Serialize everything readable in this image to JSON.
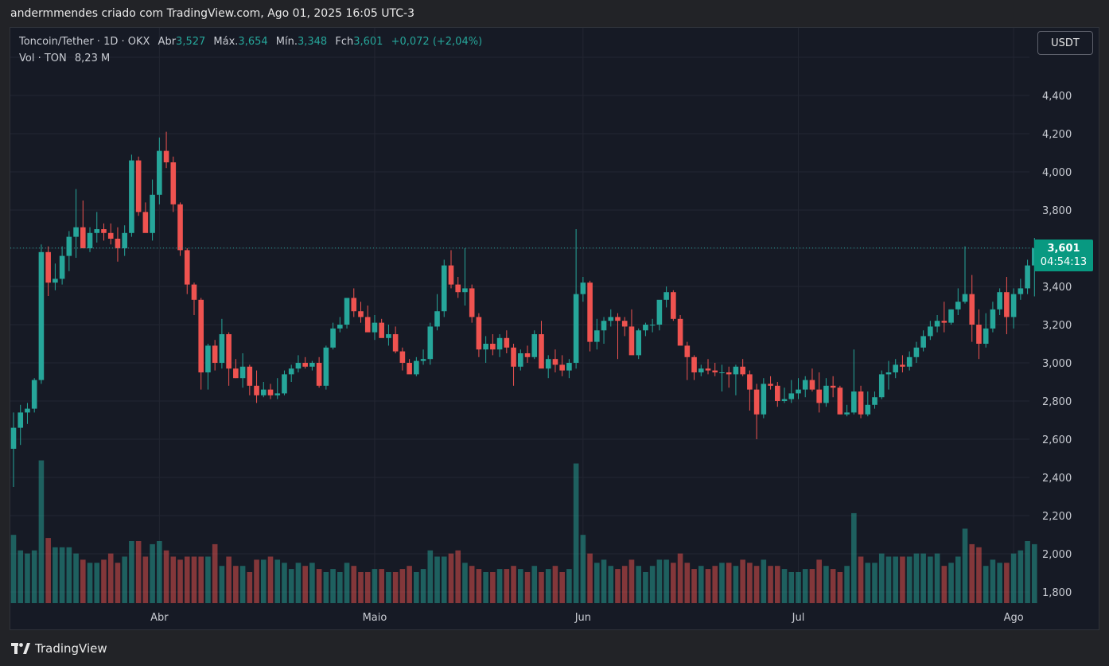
{
  "caption": "andermmendes criado com TradingView.com, Ago 01, 2025 16:05 UTC-3",
  "legend": {
    "symbol": "Toncoin/Tether · 1D · OKX",
    "open_label": "Abr",
    "open_value": "3,527",
    "high_label": "Máx.",
    "high_value": "3,654",
    "low_label": "Mín.",
    "low_value": "3,348",
    "close_label": "Fch",
    "close_value": "3,601",
    "change": "+0,072 (+2,04%)"
  },
  "volume_legend": {
    "label": "Vol · TON",
    "value": "8,23 M"
  },
  "currency_button": "USDT",
  "price_tag": {
    "last": "3,601",
    "countdown": "04:54:13"
  },
  "footer_brand": "TradingView",
  "colors": {
    "up": "#26a69a",
    "down": "#ef5350",
    "background": "#161a25",
    "grid": "#232632"
  },
  "chart_data": {
    "type": "candlestick",
    "y_axis_ticks": [
      "4,400",
      "4,200",
      "4,000",
      "3,800",
      "3,600",
      "3,400",
      "3,200",
      "3,000",
      "2,800",
      "2,600",
      "2,400",
      "2,200",
      "2,000",
      "1,800"
    ],
    "x_axis_labels": [
      "Abr",
      "Maio",
      "Jun",
      "Jul",
      "Ago"
    ],
    "ylim": [
      1.75,
      4.6
    ],
    "last_price": 3.601,
    "candles": [
      [
        2.55,
        2.74,
        2.35,
        2.66,
        2.2
      ],
      [
        2.66,
        2.78,
        2.57,
        2.74,
        1.7
      ],
      [
        2.74,
        2.79,
        2.68,
        2.76,
        1.6
      ],
      [
        2.76,
        2.92,
        2.74,
        2.91,
        1.7
      ],
      [
        2.91,
        3.62,
        2.89,
        3.58,
        4.6
      ],
      [
        3.58,
        3.61,
        3.35,
        3.42,
        2.1
      ],
      [
        3.42,
        3.52,
        3.38,
        3.44,
        1.8
      ],
      [
        3.44,
        3.61,
        3.41,
        3.56,
        1.8
      ],
      [
        3.56,
        3.69,
        3.48,
        3.66,
        1.8
      ],
      [
        3.66,
        3.91,
        3.55,
        3.71,
        1.6
      ],
      [
        3.71,
        3.85,
        3.6,
        3.6,
        1.4
      ],
      [
        3.6,
        3.71,
        3.58,
        3.68,
        1.3
      ],
      [
        3.68,
        3.79,
        3.63,
        3.7,
        1.3
      ],
      [
        3.7,
        3.73,
        3.64,
        3.68,
        1.4
      ],
      [
        3.68,
        3.73,
        3.62,
        3.65,
        1.6
      ],
      [
        3.65,
        3.71,
        3.53,
        3.6,
        1.3
      ],
      [
        3.6,
        3.72,
        3.56,
        3.68,
        1.5
      ],
      [
        3.68,
        4.09,
        3.66,
        4.06,
        2.0
      ],
      [
        4.06,
        4.08,
        3.77,
        3.79,
        2.0
      ],
      [
        3.79,
        3.84,
        3.69,
        3.68,
        1.5
      ],
      [
        3.68,
        3.96,
        3.64,
        3.88,
        1.9
      ],
      [
        3.88,
        4.18,
        3.83,
        4.11,
        2.0
      ],
      [
        4.11,
        4.21,
        4.02,
        4.05,
        1.7
      ],
      [
        4.05,
        4.08,
        3.79,
        3.83,
        1.5
      ],
      [
        3.83,
        3.84,
        3.56,
        3.59,
        1.4
      ],
      [
        3.59,
        3.6,
        3.36,
        3.41,
        1.5
      ],
      [
        3.41,
        3.42,
        3.25,
        3.33,
        1.5
      ],
      [
        3.33,
        3.34,
        2.86,
        2.95,
        1.5
      ],
      [
        2.95,
        3.1,
        2.86,
        3.09,
        1.5
      ],
      [
        3.09,
        3.12,
        2.96,
        3.0,
        1.9
      ],
      [
        3.0,
        3.23,
        2.97,
        3.15,
        1.2
      ],
      [
        3.15,
        3.16,
        2.88,
        2.97,
        1.5
      ],
      [
        2.97,
        3.02,
        2.92,
        2.92,
        1.2
      ],
      [
        2.92,
        3.05,
        2.87,
        2.98,
        1.2
      ],
      [
        2.98,
        2.99,
        2.83,
        2.88,
        1.0
      ],
      [
        2.88,
        2.96,
        2.79,
        2.83,
        1.4
      ],
      [
        2.83,
        2.9,
        2.82,
        2.86,
        1.4
      ],
      [
        2.86,
        2.89,
        2.81,
        2.83,
        1.5
      ],
      [
        2.83,
        2.92,
        2.81,
        2.84,
        1.4
      ],
      [
        2.84,
        2.96,
        2.83,
        2.94,
        1.3
      ],
      [
        2.94,
        2.99,
        2.9,
        2.97,
        1.1
      ],
      [
        2.97,
        3.04,
        2.95,
        3.0,
        1.3
      ],
      [
        3.0,
        3.03,
        2.97,
        2.98,
        1.2
      ],
      [
        2.98,
        3.01,
        2.96,
        3.0,
        1.3
      ],
      [
        3.0,
        3.03,
        2.87,
        2.88,
        1.1
      ],
      [
        2.88,
        3.09,
        2.86,
        3.08,
        1.0
      ],
      [
        3.08,
        3.21,
        3.07,
        3.18,
        1.1
      ],
      [
        3.18,
        3.24,
        3.16,
        3.2,
        1.0
      ],
      [
        3.2,
        3.31,
        3.18,
        3.34,
        1.3
      ],
      [
        3.34,
        3.39,
        3.24,
        3.27,
        1.2
      ],
      [
        3.27,
        3.32,
        3.21,
        3.24,
        1.0
      ],
      [
        3.24,
        3.3,
        3.17,
        3.16,
        1.0
      ],
      [
        3.16,
        3.25,
        3.12,
        3.21,
        1.1
      ],
      [
        3.21,
        3.23,
        3.15,
        3.13,
        1.1
      ],
      [
        3.13,
        3.2,
        3.09,
        3.15,
        1.0
      ],
      [
        3.15,
        3.19,
        3.05,
        3.06,
        1.0
      ],
      [
        3.06,
        3.08,
        2.96,
        3.0,
        1.1
      ],
      [
        3.0,
        3.02,
        2.95,
        2.94,
        1.2
      ],
      [
        2.94,
        3.03,
        2.93,
        3.01,
        1.0
      ],
      [
        3.01,
        3.07,
        2.99,
        3.02,
        1.1
      ],
      [
        3.02,
        3.21,
        2.99,
        3.19,
        1.7
      ],
      [
        3.19,
        3.36,
        3.17,
        3.27,
        1.5
      ],
      [
        3.27,
        3.54,
        3.24,
        3.51,
        1.5
      ],
      [
        3.51,
        3.59,
        3.39,
        3.41,
        1.6
      ],
      [
        3.41,
        3.45,
        3.34,
        3.37,
        1.7
      ],
      [
        3.37,
        3.6,
        3.3,
        3.39,
        1.3
      ],
      [
        3.39,
        3.41,
        3.21,
        3.24,
        1.2
      ],
      [
        3.24,
        3.26,
        3.03,
        3.07,
        1.1
      ],
      [
        3.07,
        3.14,
        3.0,
        3.1,
        1.0
      ],
      [
        3.1,
        3.15,
        3.04,
        3.07,
        1.0
      ],
      [
        3.07,
        3.15,
        3.03,
        3.13,
        1.1
      ],
      [
        3.13,
        3.17,
        3.05,
        3.08,
        1.1
      ],
      [
        3.08,
        3.1,
        2.88,
        2.98,
        1.2
      ],
      [
        2.98,
        3.07,
        2.96,
        3.05,
        1.1
      ],
      [
        3.05,
        3.09,
        3.0,
        3.03,
        1.0
      ],
      [
        3.03,
        3.17,
        3.02,
        3.15,
        1.2
      ],
      [
        3.15,
        3.22,
        3.02,
        2.97,
        1.0
      ],
      [
        2.97,
        3.04,
        2.92,
        3.02,
        1.1
      ],
      [
        3.02,
        3.07,
        2.95,
        2.99,
        1.2
      ],
      [
        2.99,
        3.04,
        2.93,
        2.96,
        1.0
      ],
      [
        2.96,
        3.02,
        2.92,
        3.0,
        1.1
      ],
      [
        3.0,
        3.7,
        2.97,
        3.36,
        4.5
      ],
      [
        3.36,
        3.45,
        3.32,
        3.42,
        2.2
      ],
      [
        3.42,
        3.43,
        3.06,
        3.11,
        1.6
      ],
      [
        3.11,
        3.23,
        3.07,
        3.17,
        1.3
      ],
      [
        3.17,
        3.24,
        3.1,
        3.22,
        1.4
      ],
      [
        3.22,
        3.28,
        3.19,
        3.24,
        1.2
      ],
      [
        3.24,
        3.26,
        3.02,
        3.22,
        1.1
      ],
      [
        3.22,
        3.24,
        3.14,
        3.19,
        1.2
      ],
      [
        3.19,
        3.28,
        3.05,
        3.04,
        1.4
      ],
      [
        3.04,
        3.18,
        3.02,
        3.17,
        1.2
      ],
      [
        3.17,
        3.21,
        3.14,
        3.2,
        1.0
      ],
      [
        3.2,
        3.23,
        3.16,
        3.2,
        1.2
      ],
      [
        3.2,
        3.31,
        3.17,
        3.33,
        1.4
      ],
      [
        3.33,
        3.4,
        3.29,
        3.37,
        1.4
      ],
      [
        3.37,
        3.38,
        3.22,
        3.23,
        1.3
      ],
      [
        3.23,
        3.25,
        3.1,
        3.09,
        1.6
      ],
      [
        3.09,
        3.11,
        2.91,
        3.03,
        1.3
      ],
      [
        3.03,
        3.04,
        2.91,
        2.95,
        1.1
      ],
      [
        2.95,
        2.99,
        2.93,
        2.97,
        1.2
      ],
      [
        2.97,
        3.02,
        2.94,
        2.96,
        1.1
      ],
      [
        2.96,
        3.0,
        2.93,
        2.95,
        1.2
      ],
      [
        2.95,
        2.99,
        2.85,
        2.95,
        1.3
      ],
      [
        2.95,
        2.98,
        2.87,
        2.94,
        1.3
      ],
      [
        2.94,
        2.99,
        2.83,
        2.98,
        1.2
      ],
      [
        2.98,
        3.02,
        2.93,
        2.94,
        1.4
      ],
      [
        2.94,
        2.96,
        2.75,
        2.86,
        1.3
      ],
      [
        2.86,
        2.89,
        2.6,
        2.73,
        1.2
      ],
      [
        2.73,
        2.92,
        2.71,
        2.89,
        1.4
      ],
      [
        2.89,
        2.93,
        2.86,
        2.88,
        1.2
      ],
      [
        2.88,
        2.9,
        2.77,
        2.8,
        1.2
      ],
      [
        2.8,
        2.87,
        2.79,
        2.81,
        1.1
      ],
      [
        2.81,
        2.91,
        2.79,
        2.84,
        1.0
      ],
      [
        2.84,
        2.92,
        2.81,
        2.86,
        1.0
      ],
      [
        2.86,
        2.93,
        2.82,
        2.91,
        1.1
      ],
      [
        2.91,
        2.97,
        2.85,
        2.86,
        1.1
      ],
      [
        2.86,
        2.95,
        2.74,
        2.79,
        1.4
      ],
      [
        2.79,
        2.92,
        2.77,
        2.88,
        1.2
      ],
      [
        2.88,
        2.93,
        2.82,
        2.87,
        1.1
      ],
      [
        2.87,
        2.88,
        2.73,
        2.73,
        1.0
      ],
      [
        2.73,
        2.78,
        2.72,
        2.74,
        1.2
      ],
      [
        2.74,
        3.07,
        2.73,
        2.85,
        2.9
      ],
      [
        2.85,
        2.88,
        2.71,
        2.73,
        1.5
      ],
      [
        2.73,
        2.85,
        2.72,
        2.78,
        1.3
      ],
      [
        2.78,
        2.85,
        2.76,
        2.82,
        1.3
      ],
      [
        2.82,
        2.96,
        2.81,
        2.94,
        1.6
      ],
      [
        2.94,
        3.01,
        2.86,
        2.95,
        1.5
      ],
      [
        2.95,
        3.02,
        2.92,
        2.99,
        1.5
      ],
      [
        2.99,
        3.04,
        2.95,
        2.98,
        1.5
      ],
      [
        2.98,
        3.06,
        2.96,
        3.03,
        1.5
      ],
      [
        3.03,
        3.11,
        3.0,
        3.08,
        1.6
      ],
      [
        3.08,
        3.17,
        3.06,
        3.14,
        1.6
      ],
      [
        3.14,
        3.22,
        3.12,
        3.19,
        1.5
      ],
      [
        3.19,
        3.25,
        3.16,
        3.22,
        1.6
      ],
      [
        3.22,
        3.32,
        3.16,
        3.21,
        1.2
      ],
      [
        3.21,
        3.28,
        3.2,
        3.28,
        1.3
      ],
      [
        3.28,
        3.39,
        3.25,
        3.32,
        1.5
      ],
      [
        3.32,
        3.61,
        3.31,
        3.36,
        2.4
      ],
      [
        3.36,
        3.46,
        3.11,
        3.2,
        1.9
      ],
      [
        3.2,
        3.28,
        3.02,
        3.1,
        1.8
      ],
      [
        3.1,
        3.26,
        3.08,
        3.18,
        1.2
      ],
      [
        3.18,
        3.32,
        3.16,
        3.28,
        1.4
      ],
      [
        3.28,
        3.39,
        3.25,
        3.37,
        1.3
      ],
      [
        3.37,
        3.45,
        3.15,
        3.24,
        1.3
      ],
      [
        3.24,
        3.39,
        3.18,
        3.36,
        1.6
      ],
      [
        3.36,
        3.44,
        3.33,
        3.39,
        1.7
      ],
      [
        3.39,
        3.54,
        3.36,
        3.51,
        2.0
      ],
      [
        3.51,
        3.654,
        3.348,
        3.601,
        1.9
      ]
    ]
  }
}
